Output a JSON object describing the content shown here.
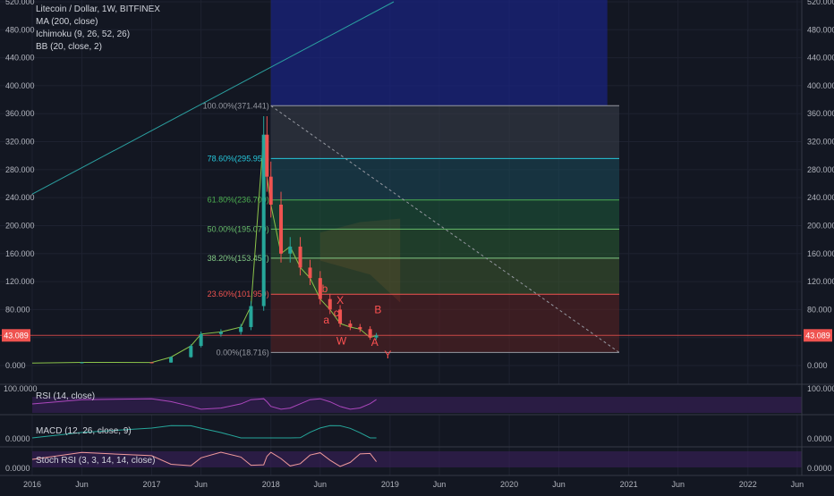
{
  "header": {
    "symbol": "Litecoin / Dollar, 1W, BITFINEX",
    "indicators": [
      "MA (200, close)",
      "Ichimoku (9, 26, 52, 26)",
      "BB (20, close, 2)"
    ]
  },
  "colors": {
    "background": "#131722",
    "grid": "#1e2230",
    "axis_text": "#b2b5be",
    "up": "#26a69a",
    "down": "#ef5350",
    "price_tag": "#ef5350",
    "trendline": "#2ba0a0",
    "wave_labels": "#ff5252",
    "rsi_band": "#3b1f5c",
    "stoch_band": "#3b1f5c"
  },
  "price_tag": "43.089",
  "wave_labels": [
    "b",
    "X",
    "a",
    "c",
    "W",
    "B",
    "A",
    "Y"
  ],
  "panes": {
    "rsi": {
      "label": "RSI (14, close)",
      "axis_label": "100.0000"
    },
    "macd": {
      "label": "MACD (12, 26, close, 9)",
      "axis_label": "0.0000"
    },
    "stoch": {
      "label": "Stoch RSI (3, 3, 14, 14, close)",
      "axis_label": "0.0000"
    }
  },
  "chart_data": {
    "type": "candlestick",
    "title": "Litecoin / Dollar, 1W, BITFINEX",
    "y_ticks": [
      0,
      40,
      80,
      120,
      160,
      200,
      240,
      280,
      320,
      360,
      400,
      440,
      480,
      520
    ],
    "y_tick_labels": [
      "0.000",
      "40.000",
      "80.000",
      "120.000",
      "160.000",
      "200.000",
      "240.000",
      "280.000",
      "320.000",
      "360.000",
      "400.000",
      "440.000",
      "480.000",
      "520.000"
    ],
    "ylim": [
      -20,
      530
    ],
    "x_ticks": [
      {
        "date": "2016-01",
        "label": "2016"
      },
      {
        "date": "2016-06",
        "label": "Jun"
      },
      {
        "date": "2017-01",
        "label": "2017"
      },
      {
        "date": "2017-06",
        "label": "Jun"
      },
      {
        "date": "2018-01",
        "label": "2018"
      },
      {
        "date": "2018-06",
        "label": "Jun"
      },
      {
        "date": "2019-01",
        "label": "2019"
      },
      {
        "date": "2019-06",
        "label": "Jun"
      },
      {
        "date": "2020-01",
        "label": "2020"
      },
      {
        "date": "2020-06",
        "label": "Jun"
      },
      {
        "date": "2021-01",
        "label": "2021"
      },
      {
        "date": "2021-06",
        "label": "Jun"
      },
      {
        "date": "2022-01",
        "label": "2022"
      },
      {
        "date": "2022-06",
        "label": "Jun"
      }
    ],
    "last_price": 43.089,
    "fibonacci": [
      {
        "label": "100.00%(371.441)",
        "value": 371.441,
        "color": "#9598a1"
      },
      {
        "label": "78.60%(295.958)",
        "value": 295.958,
        "color": "#26c6da"
      },
      {
        "label": "61.80%(236.700)",
        "value": 236.7,
        "color": "#4caf50"
      },
      {
        "label": "50.00%(195.079)",
        "value": 195.079,
        "color": "#66bb6a"
      },
      {
        "label": "38.20%(153.457)",
        "value": 153.457,
        "color": "#81c784"
      },
      {
        "label": "23.60%(101.959)",
        "value": 101.959,
        "color": "#ef5350"
      },
      {
        "label": "0.00%(18.716)",
        "value": 18.716,
        "color": "#9598a1"
      }
    ],
    "series": [
      {
        "name": "Close",
        "points": [
          [
            "2016-01",
            3.5
          ],
          [
            "2016-06",
            4.5
          ],
          [
            "2017-01",
            4.3
          ],
          [
            "2017-03",
            12
          ],
          [
            "2017-05",
            28
          ],
          [
            "2017-06",
            45
          ],
          [
            "2017-08",
            48
          ],
          [
            "2017-10",
            55
          ],
          [
            "2017-11",
            85
          ],
          [
            "2017-12-10",
            330
          ],
          [
            "2017-12-20",
            270
          ],
          [
            "2018-01",
            230
          ],
          [
            "2018-02",
            160
          ],
          [
            "2018-03",
            170
          ],
          [
            "2018-04",
            140
          ],
          [
            "2018-05",
            125
          ],
          [
            "2018-06",
            95
          ],
          [
            "2018-07",
            80
          ],
          [
            "2018-08",
            60
          ],
          [
            "2018-09",
            55
          ],
          [
            "2018-10",
            52
          ],
          [
            "2018-11",
            40
          ],
          [
            "2018-11-20",
            43.089
          ]
        ]
      }
    ]
  }
}
